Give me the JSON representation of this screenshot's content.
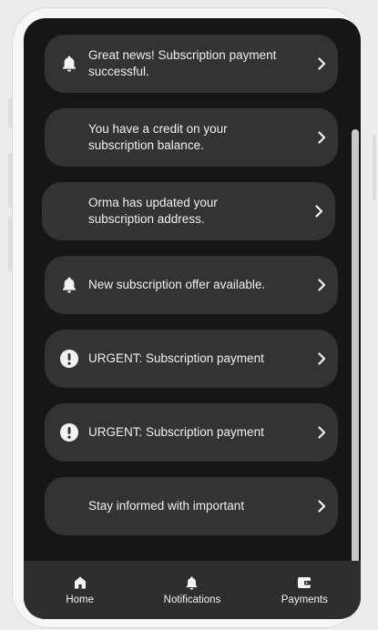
{
  "notifications": [
    {
      "icon": "bell-icon",
      "text": "Great news! Subscription payment\nsuccessful."
    },
    {
      "icon": "",
      "text": "You have a credit on your\nsubscription balance."
    },
    {
      "icon": "",
      "text": "Orma has updated your\nsubscription address."
    },
    {
      "icon": "bell-icon",
      "text": "New subscription offer available."
    },
    {
      "icon": "alert-circle-icon",
      "text": "URGENT: Subscription payment"
    },
    {
      "icon": "alert-circle-icon",
      "text": "URGENT: Subscription payment"
    },
    {
      "icon": "",
      "text": "Stay informed with important"
    }
  ],
  "nav": {
    "home": {
      "label": "Home",
      "icon": "home-icon"
    },
    "notifications": {
      "label": "Notifications",
      "icon": "bell-icon"
    },
    "payments": {
      "label": "Payments",
      "icon": "wallet-icon"
    }
  },
  "colors": {
    "background": "#161616",
    "card": "#333333",
    "nav": "#2e2e2e",
    "text": "#f0f0f0"
  }
}
